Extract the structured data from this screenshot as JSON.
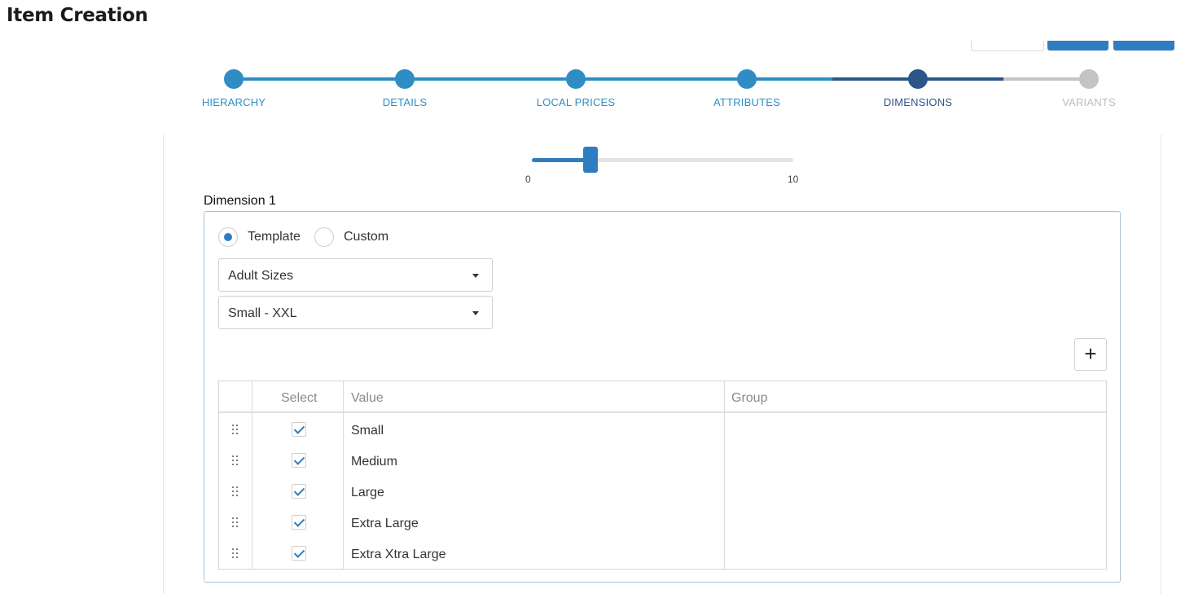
{
  "page": {
    "title": "Item Creation"
  },
  "stepper": {
    "steps": [
      {
        "label": "HIERARCHY",
        "state": "complete"
      },
      {
        "label": "DETAILS",
        "state": "complete"
      },
      {
        "label": "LOCAL PRICES",
        "state": "complete"
      },
      {
        "label": "ATTRIBUTES",
        "state": "complete"
      },
      {
        "label": "DIMENSIONS",
        "state": "active"
      },
      {
        "label": "VARIANTS",
        "state": "pending"
      }
    ],
    "colors": {
      "complete": "#2f8dc4",
      "active": "#2a5788",
      "pending": "#c4c4c4"
    }
  },
  "slider": {
    "min_label": "0",
    "max_label": "10",
    "min": 0,
    "max": 10,
    "value": 2
  },
  "dimension": {
    "title": "Dimension 1",
    "mode_options": [
      {
        "label": "Template",
        "selected": true
      },
      {
        "label": "Custom",
        "selected": false
      }
    ],
    "template_select": {
      "value": "Adult Sizes"
    },
    "range_select": {
      "value": "Small - XXL"
    },
    "add_button_label": "+",
    "table": {
      "columns": [
        "",
        "Select",
        "Value",
        "Group"
      ],
      "rows": [
        {
          "selected": true,
          "value": "Small",
          "group": ""
        },
        {
          "selected": true,
          "value": "Medium",
          "group": ""
        },
        {
          "selected": true,
          "value": "Large",
          "group": ""
        },
        {
          "selected": true,
          "value": "Extra Large",
          "group": ""
        },
        {
          "selected": true,
          "value": "Extra Xtra Large",
          "group": ""
        }
      ]
    }
  },
  "theme": {
    "accent": "#2f7dc1"
  }
}
